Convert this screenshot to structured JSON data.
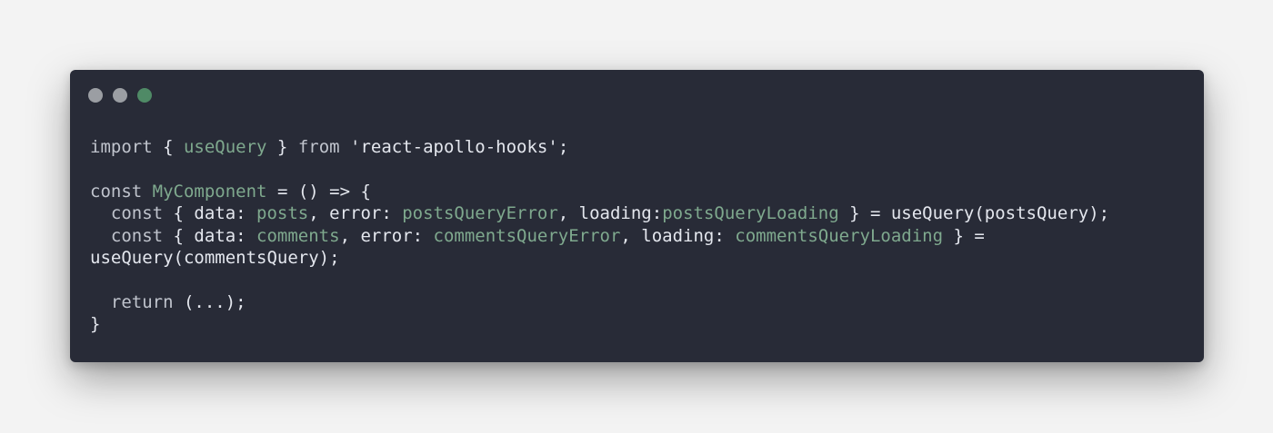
{
  "window": {
    "controls": [
      {
        "name": "close",
        "color": "#9b9ea3"
      },
      {
        "name": "minimize",
        "color": "#9b9ea3"
      },
      {
        "name": "zoom",
        "color": "#4f8a66"
      }
    ]
  },
  "colors": {
    "background": "#282b37",
    "keyword": "#c0c4cd",
    "identifier": "#7fa98e",
    "text": "#e4e7ee"
  },
  "code": {
    "lines": [
      [
        {
          "t": "import",
          "c": "kw"
        },
        {
          "t": " { ",
          "c": "plain"
        },
        {
          "t": "useQuery",
          "c": "id"
        },
        {
          "t": " } ",
          "c": "plain"
        },
        {
          "t": "from",
          "c": "kw"
        },
        {
          "t": " ",
          "c": "plain"
        },
        {
          "t": "'react-apollo-hooks'",
          "c": "str"
        },
        {
          "t": ";",
          "c": "plain"
        }
      ],
      [],
      [
        {
          "t": "const",
          "c": "kw"
        },
        {
          "t": " ",
          "c": "plain"
        },
        {
          "t": "MyComponent",
          "c": "id"
        },
        {
          "t": " = () => {",
          "c": "plain"
        }
      ],
      [
        {
          "t": "  ",
          "c": "plain"
        },
        {
          "t": "const",
          "c": "kw"
        },
        {
          "t": " { data: ",
          "c": "plain"
        },
        {
          "t": "posts",
          "c": "id"
        },
        {
          "t": ", error: ",
          "c": "plain"
        },
        {
          "t": "postsQueryError",
          "c": "id"
        },
        {
          "t": ", loading:",
          "c": "plain"
        },
        {
          "t": "postsQueryLoading",
          "c": "id"
        },
        {
          "t": " } = useQuery(postsQuery);",
          "c": "plain"
        }
      ],
      [
        {
          "t": "  ",
          "c": "plain"
        },
        {
          "t": "const",
          "c": "kw"
        },
        {
          "t": " { data: ",
          "c": "plain"
        },
        {
          "t": "comments",
          "c": "id"
        },
        {
          "t": ", error: ",
          "c": "plain"
        },
        {
          "t": "commentsQueryError",
          "c": "id"
        },
        {
          "t": ", loading: ",
          "c": "plain"
        },
        {
          "t": "commentsQueryLoading",
          "c": "id"
        },
        {
          "t": " } =",
          "c": "plain"
        }
      ],
      [
        {
          "t": "useQuery(commentsQuery);",
          "c": "plain"
        }
      ],
      [],
      [
        {
          "t": "  ",
          "c": "plain"
        },
        {
          "t": "return",
          "c": "kw"
        },
        {
          "t": " (...);",
          "c": "plain"
        }
      ],
      [
        {
          "t": "}",
          "c": "plain"
        }
      ]
    ]
  }
}
